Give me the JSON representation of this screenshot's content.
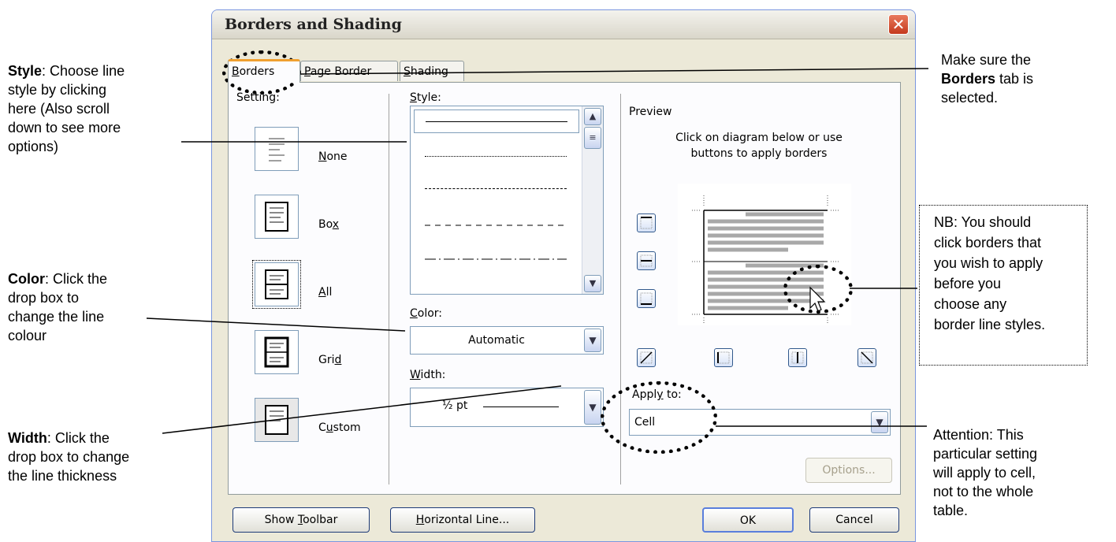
{
  "dialog": {
    "title": "Borders and Shading",
    "close_glyph": "✕",
    "tabs": [
      {
        "pre": "",
        "u": "B",
        "post": "orders"
      },
      {
        "pre": "",
        "u": "P",
        "post": "age Border"
      },
      {
        "pre": "",
        "u": "S",
        "post": "hading"
      }
    ],
    "setting_label": "Setting:",
    "settings": [
      {
        "pre": "",
        "u": "N",
        "post": "one"
      },
      {
        "pre": "Bo",
        "u": "x",
        "post": ""
      },
      {
        "pre": "",
        "u": "A",
        "post": "ll"
      },
      {
        "pre": "Gri",
        "u": "d",
        "post": ""
      },
      {
        "pre": "C",
        "u": "u",
        "post": "stom"
      }
    ],
    "style_label": {
      "pre": "",
      "u": "S",
      "post": "tyle:"
    },
    "color_label": {
      "pre": "",
      "u": "C",
      "post": "olor:"
    },
    "color_value": "Automatic",
    "width_label": {
      "pre": "",
      "u": "W",
      "post": "idth:"
    },
    "width_value": "½ pt",
    "preview_label": "Preview",
    "preview_hint_1": "Click on diagram below or use",
    "preview_hint_2": "buttons to apply borders",
    "apply_label": {
      "pre": "Appl",
      "u": "y",
      "post": " to:"
    },
    "apply_value": "Cell",
    "options_button": "Options...",
    "show_toolbar": {
      "pre": "Show ",
      "u": "T",
      "post": "oolbar"
    },
    "horizontal_line": {
      "pre": "",
      "u": "H",
      "post": "orizontal Line..."
    },
    "ok": "OK",
    "cancel": "Cancel"
  },
  "annotations": {
    "style": {
      "bold": "Style",
      "lines": [
        ": Choose line",
        "style by clicking",
        "here (Also scroll",
        "down to see more",
        "options)"
      ]
    },
    "color": {
      "bold": "Color",
      "lines": [
        ": Click the",
        "drop box to",
        "change the line",
        "colour"
      ]
    },
    "width": {
      "bold": "Width",
      "lines": [
        ": Click the",
        "drop box to change",
        "the line thickness"
      ]
    },
    "borders": {
      "l1": "Make sure the",
      "bold": "Borders",
      "l2": " tab is",
      "l3": "selected."
    },
    "nb": {
      "lines": [
        "NB: You should",
        "click borders that",
        "you wish to apply",
        "before you",
        "choose any",
        "border line styles."
      ]
    },
    "attention": {
      "lines": [
        "Attention: This",
        "particular setting",
        "will apply to cell,",
        "not to the whole",
        "table."
      ]
    }
  }
}
